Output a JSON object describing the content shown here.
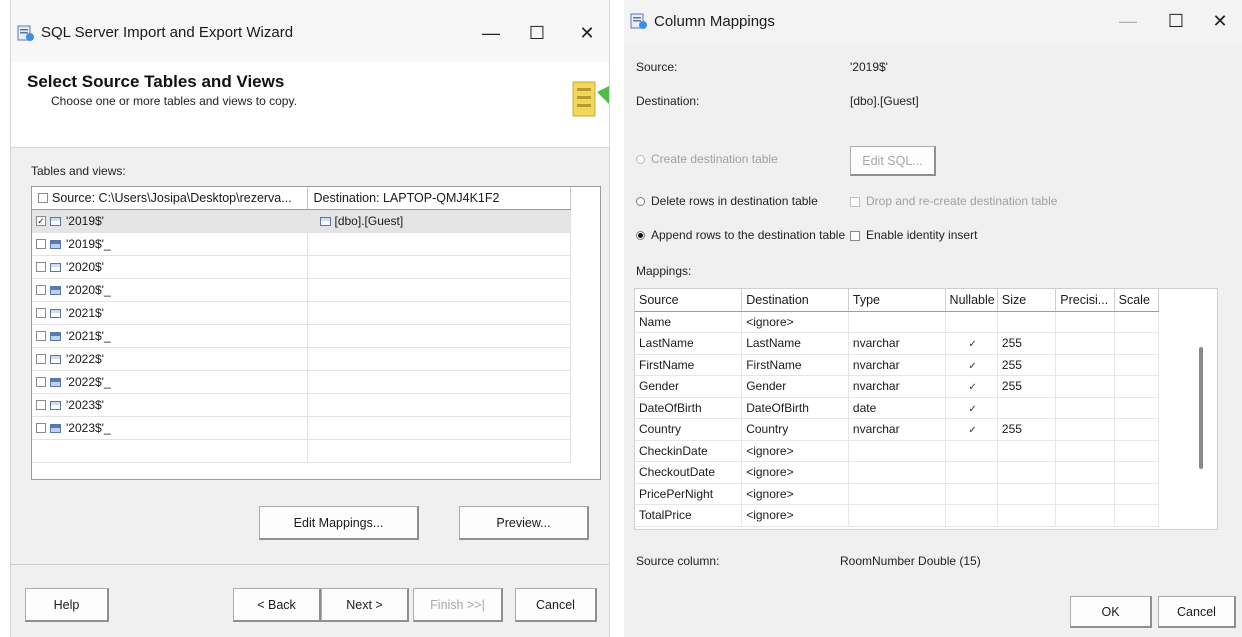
{
  "wizard": {
    "title": "SQL Server Import and Export Wizard",
    "controls": {
      "minimize": "—",
      "maximize": "☐",
      "close": "✕"
    },
    "header": {
      "title": "Select Source Tables and Views",
      "subtitle": "Choose one or more tables and views to copy."
    },
    "tables_label": "Tables and views:",
    "columns": [
      "Source: C:\\Users\\Josipa\\Desktop\\rezerva...",
      "Destination: LAPTOP-QMJ4K1F2"
    ],
    "rows": [
      {
        "source": "'2019$'",
        "destination": "[dbo].[Guest]",
        "checked": true,
        "selected": true,
        "icon": "table-icon"
      },
      {
        "source": "'2019$'_",
        "destination": "",
        "checked": false,
        "selected": false,
        "icon": "view-icon"
      },
      {
        "source": "'2020$'",
        "destination": "",
        "checked": false,
        "selected": false,
        "icon": "table-icon"
      },
      {
        "source": "'2020$'_",
        "destination": "",
        "checked": false,
        "selected": false,
        "icon": "view-icon"
      },
      {
        "source": "'2021$'",
        "destination": "",
        "checked": false,
        "selected": false,
        "icon": "table-icon"
      },
      {
        "source": "'2021$'_",
        "destination": "",
        "checked": false,
        "selected": false,
        "icon": "view-icon"
      },
      {
        "source": "'2022$'",
        "destination": "",
        "checked": false,
        "selected": false,
        "icon": "table-icon"
      },
      {
        "source": "'2022$'_",
        "destination": "",
        "checked": false,
        "selected": false,
        "icon": "view-icon"
      },
      {
        "source": "'2023$'",
        "destination": "",
        "checked": false,
        "selected": false,
        "icon": "table-icon"
      },
      {
        "source": "'2023$'_",
        "destination": "",
        "checked": false,
        "selected": false,
        "icon": "view-icon"
      }
    ],
    "buttons": {
      "edit_mappings": "Edit Mappings...",
      "preview": "Preview...",
      "help": "Help",
      "back": "< Back",
      "next": "Next >",
      "finish": "Finish >>|",
      "cancel": "Cancel"
    }
  },
  "mappings": {
    "title": "Column Mappings",
    "controls": {
      "minimize": "—",
      "maximize": "☐",
      "close": "✕"
    },
    "source_label": "Source:",
    "source_value": "'2019$'",
    "destination_label": "Destination:",
    "destination_value": "[dbo].[Guest]",
    "options": {
      "create": "Create destination table",
      "edit_sql": "Edit SQL...",
      "delete_rows": "Delete rows in destination table",
      "drop_recreate": "Drop and re-create destination table",
      "append_rows": "Append rows to the destination table",
      "identity_insert": "Enable identity insert"
    },
    "mappings_label": "Mappings:",
    "columns": [
      "Source",
      "Destination",
      "Type",
      "Nullable",
      "Size",
      "Precisi...",
      "Scale"
    ],
    "rows": [
      {
        "source": "Name",
        "destination": "<ignore>",
        "type": "",
        "nullable": false,
        "size": ""
      },
      {
        "source": "LastName",
        "destination": "LastName",
        "type": "nvarchar",
        "nullable": true,
        "size": "255"
      },
      {
        "source": "FirstName",
        "destination": "FirstName",
        "type": "nvarchar",
        "nullable": true,
        "size": "255"
      },
      {
        "source": "Gender",
        "destination": "Gender",
        "type": "nvarchar",
        "nullable": true,
        "size": "255"
      },
      {
        "source": "DateOfBirth",
        "destination": "DateOfBirth",
        "type": "date",
        "nullable": true,
        "size": ""
      },
      {
        "source": "Country",
        "destination": "Country",
        "type": "nvarchar",
        "nullable": true,
        "size": "255"
      },
      {
        "source": "CheckinDate",
        "destination": "<ignore>",
        "type": "",
        "nullable": false,
        "size": ""
      },
      {
        "source": "CheckoutDate",
        "destination": "<ignore>",
        "type": "",
        "nullable": false,
        "size": ""
      },
      {
        "source": "PricePerNight",
        "destination": "<ignore>",
        "type": "",
        "nullable": false,
        "size": ""
      },
      {
        "source": "TotalPrice",
        "destination": "<ignore>",
        "type": "",
        "nullable": false,
        "size": ""
      }
    ],
    "source_column_label": "Source column:",
    "source_column_value": "RoomNumber Double (15)",
    "buttons": {
      "ok": "OK",
      "cancel": "Cancel"
    }
  }
}
